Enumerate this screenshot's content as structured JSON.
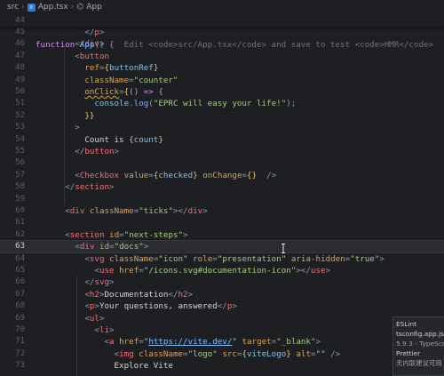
{
  "breadcrumb": {
    "folder": "src",
    "file": "App.tsx",
    "symbol": "App",
    "file_icon": "tsx-file-icon",
    "symbol_icon": "component-icon"
  },
  "sticky": {
    "line_number": "44",
    "tokens": [
      {
        "t": "function ",
        "c": "t-kw"
      },
      {
        "t": "App",
        "c": "t-fn"
      },
      {
        "t": "() {",
        "c": "t-punct"
      }
    ],
    "faded": "Edit <code>src/App.tsx</code> and save to test <code>HMR</code>"
  },
  "lines": [
    {
      "n": "45",
      "tokens": [
        {
          "t": "          "
        },
        {
          "t": "</",
          "c": "t-punct"
        },
        {
          "t": "p",
          "c": "t-tag"
        },
        {
          "t": ">",
          "c": "t-punct"
        }
      ]
    },
    {
      "n": "46",
      "tokens": [
        {
          "t": "        "
        },
        {
          "t": "</",
          "c": "t-punct"
        },
        {
          "t": "div",
          "c": "t-tag"
        },
        {
          "t": ">",
          "c": "t-punct"
        }
      ]
    },
    {
      "n": "47",
      "tokens": [
        {
          "t": "        "
        },
        {
          "t": "<",
          "c": "t-punct"
        },
        {
          "t": "button",
          "c": "t-tag"
        }
      ]
    },
    {
      "n": "48",
      "tokens": [
        {
          "t": "          "
        },
        {
          "t": "ref",
          "c": "t-attr"
        },
        {
          "t": "=",
          "c": "t-punct"
        },
        {
          "t": "{",
          "c": "t-brace"
        },
        {
          "t": "buttonRef",
          "c": "t-var"
        },
        {
          "t": "}",
          "c": "t-brace"
        }
      ]
    },
    {
      "n": "49",
      "tokens": [
        {
          "t": "          "
        },
        {
          "t": "className",
          "c": "t-attr"
        },
        {
          "t": "=",
          "c": "t-punct"
        },
        {
          "t": "\"counter\"",
          "c": "t-str"
        }
      ]
    },
    {
      "n": "50",
      "tokens": [
        {
          "t": "          "
        },
        {
          "t": "onClick",
          "c": "t-attr under"
        },
        {
          "t": "=",
          "c": "t-punct"
        },
        {
          "t": "{",
          "c": "t-brace"
        },
        {
          "t": "() => {",
          "c": "t-kw"
        }
      ]
    },
    {
      "n": "51",
      "tokens": [
        {
          "t": "            "
        },
        {
          "t": "console",
          "c": "t-var"
        },
        {
          "t": ".",
          "c": "t-punct"
        },
        {
          "t": "log",
          "c": "t-fn"
        },
        {
          "t": "(",
          "c": "t-punct"
        },
        {
          "t": "\"EPRC will easy your life!\"",
          "c": "t-str"
        },
        {
          "t": ");",
          "c": "t-punct"
        }
      ]
    },
    {
      "n": "52",
      "tokens": [
        {
          "t": "          "
        },
        {
          "t": "}}",
          "c": "t-brace"
        }
      ]
    },
    {
      "n": "53",
      "tokens": [
        {
          "t": "        "
        },
        {
          "t": ">",
          "c": "t-punct"
        }
      ]
    },
    {
      "n": "54",
      "tokens": [
        {
          "t": "          Count is "
        },
        {
          "t": "{",
          "c": "t-brace"
        },
        {
          "t": "count",
          "c": "t-var"
        },
        {
          "t": "}",
          "c": "t-brace"
        }
      ]
    },
    {
      "n": "55",
      "tokens": [
        {
          "t": "        "
        },
        {
          "t": "</",
          "c": "t-punct"
        },
        {
          "t": "button",
          "c": "t-tag"
        },
        {
          "t": ">",
          "c": "t-punct"
        }
      ]
    },
    {
      "n": "56",
      "tokens": []
    },
    {
      "n": "57",
      "tokens": [
        {
          "t": "        "
        },
        {
          "t": "<",
          "c": "t-punct"
        },
        {
          "t": "Checkbox",
          "c": "t-tag"
        },
        {
          "t": " "
        },
        {
          "t": "value",
          "c": "t-attr"
        },
        {
          "t": "=",
          "c": "t-punct"
        },
        {
          "t": "{",
          "c": "t-brace"
        },
        {
          "t": "checked",
          "c": "t-var"
        },
        {
          "t": "}",
          "c": "t-brace"
        },
        {
          "t": " "
        },
        {
          "t": "onChange",
          "c": "t-attr"
        },
        {
          "t": "=",
          "c": "t-punct"
        },
        {
          "t": "{}",
          "c": "t-brace"
        },
        {
          "t": "  />",
          "c": "t-punct"
        }
      ]
    },
    {
      "n": "58",
      "tokens": [
        {
          "t": "      "
        },
        {
          "t": "</",
          "c": "t-punct"
        },
        {
          "t": "section",
          "c": "t-tag"
        },
        {
          "t": ">",
          "c": "t-punct"
        }
      ]
    },
    {
      "n": "59",
      "tokens": []
    },
    {
      "n": "60",
      "tokens": [
        {
          "t": "      "
        },
        {
          "t": "<",
          "c": "t-punct"
        },
        {
          "t": "div",
          "c": "t-tag"
        },
        {
          "t": " "
        },
        {
          "t": "className",
          "c": "t-attr"
        },
        {
          "t": "=",
          "c": "t-punct"
        },
        {
          "t": "\"ticks\"",
          "c": "t-str"
        },
        {
          "t": "></",
          "c": "t-punct"
        },
        {
          "t": "div",
          "c": "t-tag"
        },
        {
          "t": ">",
          "c": "t-punct"
        }
      ]
    },
    {
      "n": "61",
      "tokens": []
    },
    {
      "n": "62",
      "tokens": [
        {
          "t": "      "
        },
        {
          "t": "<",
          "c": "t-punct"
        },
        {
          "t": "section",
          "c": "t-tag"
        },
        {
          "t": " "
        },
        {
          "t": "id",
          "c": "t-attr"
        },
        {
          "t": "=",
          "c": "t-punct"
        },
        {
          "t": "\"next-steps\"",
          "c": "t-str"
        },
        {
          "t": ">",
          "c": "t-punct"
        }
      ]
    },
    {
      "n": "63",
      "current": true,
      "tokens": [
        {
          "t": "        "
        },
        {
          "t": "<",
          "c": "t-punct"
        },
        {
          "t": "div",
          "c": "t-tag"
        },
        {
          "t": " "
        },
        {
          "t": "id",
          "c": "t-attr"
        },
        {
          "t": "=",
          "c": "t-punct"
        },
        {
          "t": "\"docs\"",
          "c": "t-str"
        },
        {
          "t": ">",
          "c": "t-punct"
        }
      ]
    },
    {
      "n": "64",
      "tokens": [
        {
          "t": "          "
        },
        {
          "t": "<",
          "c": "t-punct"
        },
        {
          "t": "svg",
          "c": "t-tag"
        },
        {
          "t": " "
        },
        {
          "t": "className",
          "c": "t-attr"
        },
        {
          "t": "=",
          "c": "t-punct"
        },
        {
          "t": "\"icon\"",
          "c": "t-str"
        },
        {
          "t": " "
        },
        {
          "t": "role",
          "c": "t-attr"
        },
        {
          "t": "=",
          "c": "t-punct"
        },
        {
          "t": "\"presentation\"",
          "c": "t-str"
        },
        {
          "t": " "
        },
        {
          "t": "aria-hidden",
          "c": "t-attr"
        },
        {
          "t": "=",
          "c": "t-punct"
        },
        {
          "t": "\"true\"",
          "c": "t-str"
        },
        {
          "t": ">",
          "c": "t-punct"
        }
      ]
    },
    {
      "n": "65",
      "tokens": [
        {
          "t": "            "
        },
        {
          "t": "<",
          "c": "t-punct"
        },
        {
          "t": "use",
          "c": "t-tag"
        },
        {
          "t": " "
        },
        {
          "t": "href",
          "c": "t-attr"
        },
        {
          "t": "=",
          "c": "t-punct"
        },
        {
          "t": "\"/icons.svg#documentation-icon\"",
          "c": "t-str"
        },
        {
          "t": "></",
          "c": "t-punct"
        },
        {
          "t": "use",
          "c": "t-tag"
        },
        {
          "t": ">",
          "c": "t-punct"
        }
      ]
    },
    {
      "n": "66",
      "tokens": [
        {
          "t": "          "
        },
        {
          "t": "</",
          "c": "t-punct"
        },
        {
          "t": "svg",
          "c": "t-tag"
        },
        {
          "t": ">",
          "c": "t-punct"
        }
      ]
    },
    {
      "n": "67",
      "tokens": [
        {
          "t": "          "
        },
        {
          "t": "<",
          "c": "t-punct"
        },
        {
          "t": "h2",
          "c": "t-tag"
        },
        {
          "t": ">",
          "c": "t-punct"
        },
        {
          "t": "Documentation"
        },
        {
          "t": "</",
          "c": "t-punct"
        },
        {
          "t": "h2",
          "c": "t-tag"
        },
        {
          "t": ">",
          "c": "t-punct"
        }
      ]
    },
    {
      "n": "68",
      "tokens": [
        {
          "t": "          "
        },
        {
          "t": "<",
          "c": "t-punct"
        },
        {
          "t": "p",
          "c": "t-tag"
        },
        {
          "t": ">",
          "c": "t-punct"
        },
        {
          "t": "Your questions, answered"
        },
        {
          "t": "</",
          "c": "t-punct"
        },
        {
          "t": "p",
          "c": "t-tag"
        },
        {
          "t": ">",
          "c": "t-punct"
        }
      ]
    },
    {
      "n": "69",
      "tokens": [
        {
          "t": "          "
        },
        {
          "t": "<",
          "c": "t-punct"
        },
        {
          "t": "ul",
          "c": "t-tag"
        },
        {
          "t": ">",
          "c": "t-punct"
        }
      ]
    },
    {
      "n": "70",
      "tokens": [
        {
          "t": "            "
        },
        {
          "t": "<",
          "c": "t-punct"
        },
        {
          "t": "li",
          "c": "t-tag"
        },
        {
          "t": ">",
          "c": "t-punct"
        }
      ]
    },
    {
      "n": "71",
      "tokens": [
        {
          "t": "              "
        },
        {
          "t": "<",
          "c": "t-punct"
        },
        {
          "t": "a",
          "c": "t-tag"
        },
        {
          "t": " "
        },
        {
          "t": "href",
          "c": "t-attr"
        },
        {
          "t": "=",
          "c": "t-punct"
        },
        {
          "t": "\"",
          "c": "t-str"
        },
        {
          "t": "https://vite.dev/",
          "c": "t-link"
        },
        {
          "t": "\"",
          "c": "t-str"
        },
        {
          "t": " "
        },
        {
          "t": "target",
          "c": "t-attr"
        },
        {
          "t": "=",
          "c": "t-punct"
        },
        {
          "t": "\"_blank\"",
          "c": "t-str"
        },
        {
          "t": ">",
          "c": "t-punct"
        }
      ]
    },
    {
      "n": "72",
      "tokens": [
        {
          "t": "                "
        },
        {
          "t": "<",
          "c": "t-punct"
        },
        {
          "t": "img",
          "c": "t-tag"
        },
        {
          "t": " "
        },
        {
          "t": "className",
          "c": "t-attr"
        },
        {
          "t": "=",
          "c": "t-punct"
        },
        {
          "t": "\"logo\"",
          "c": "t-str"
        },
        {
          "t": " "
        },
        {
          "t": "src",
          "c": "t-attr"
        },
        {
          "t": "=",
          "c": "t-punct"
        },
        {
          "t": "{",
          "c": "t-brace"
        },
        {
          "t": "viteLogo",
          "c": "t-var"
        },
        {
          "t": "}",
          "c": "t-brace"
        },
        {
          "t": " "
        },
        {
          "t": "alt",
          "c": "t-attr"
        },
        {
          "t": "=",
          "c": "t-punct"
        },
        {
          "t": "\"\"",
          "c": "t-str"
        },
        {
          "t": " />",
          "c": "t-punct"
        }
      ]
    },
    {
      "n": "73",
      "tokens": [
        {
          "t": "                Explore Vite"
        }
      ]
    }
  ],
  "status_popup": {
    "items": [
      "ESLint",
      "tsconfig.app.json",
      "5.9.3 - TypeScript",
      "Prettier",
      "无内联建议可用"
    ]
  }
}
